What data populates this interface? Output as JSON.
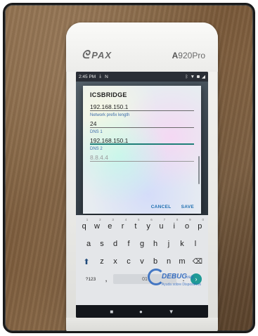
{
  "device": {
    "brand": "PAX",
    "model_letter": "A",
    "model_rest": "920Pro"
  },
  "statusbar": {
    "time": "2:45 PM",
    "indicators": [
      "download-icon",
      "nfc-icon"
    ],
    "right_icons": [
      "bluetooth-icon",
      "wifi-icon",
      "battery-icon",
      "signal-icon"
    ]
  },
  "dialog": {
    "title": "ICSBRIDGE",
    "fields": [
      {
        "label": "",
        "value": "192.168.150.1",
        "hint": false
      },
      {
        "label": "Network prefix length",
        "value": "24",
        "hint": false
      },
      {
        "label": "DNS 1",
        "value": "192.168.150.1",
        "hint": false
      },
      {
        "label": "DNS 2",
        "value": "8.8.4.4",
        "hint": true
      }
    ],
    "cancel_label": "CANCEL",
    "save_label": "SAVE"
  },
  "keyboard": {
    "row1": [
      {
        "k": "q",
        "n": "1"
      },
      {
        "k": "w",
        "n": "2"
      },
      {
        "k": "e",
        "n": "3"
      },
      {
        "k": "r",
        "n": "4"
      },
      {
        "k": "t",
        "n": "5"
      },
      {
        "k": "y",
        "n": "6"
      },
      {
        "k": "u",
        "n": "7"
      },
      {
        "k": "i",
        "n": "8"
      },
      {
        "k": "o",
        "n": "9"
      },
      {
        "k": "p",
        "n": "0"
      }
    ],
    "row2": [
      "a",
      "s",
      "d",
      "f",
      "g",
      "h",
      "j",
      "k",
      "l"
    ],
    "row3": [
      "z",
      "x",
      "c",
      "v",
      "b",
      "n",
      "m"
    ],
    "sym_label": "?123",
    "comma": ",",
    "space_label": "01",
    "period": ".",
    "shift_glyph": "⬆",
    "backspace_glyph": "⌫",
    "enter_glyph": "›"
  },
  "watermark": {
    "text": "DEBUG",
    "suffix": "rely",
    "sub": "Ayuda sobre Dispositivos"
  },
  "navbar": {
    "back": "■",
    "home": "●",
    "recents": "▼"
  }
}
